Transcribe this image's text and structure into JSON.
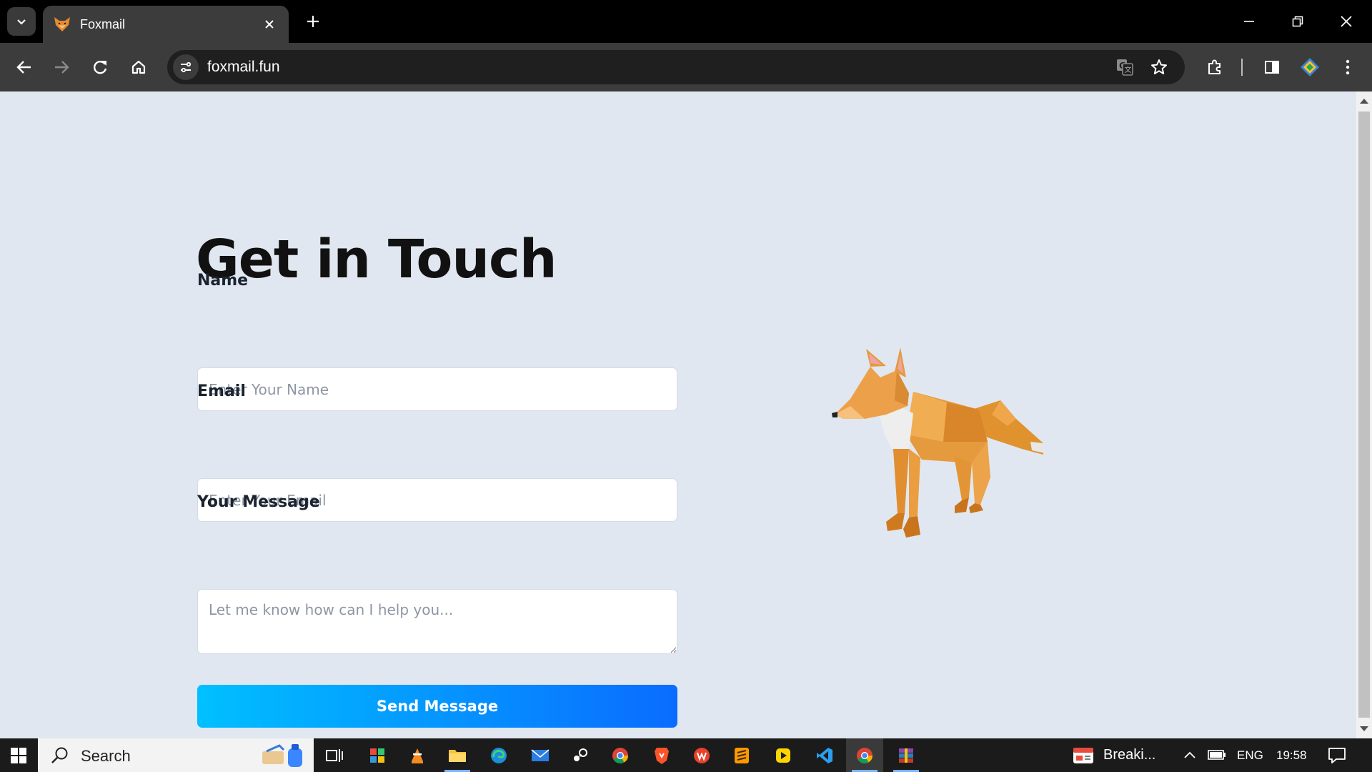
{
  "browser": {
    "tab_title": "Foxmail",
    "url": "foxmail.fun"
  },
  "page": {
    "heading": "Get in Touch",
    "name_label": "Name",
    "name_placeholder": "Enter Your Name",
    "email_label": "Email",
    "email_placeholder": "Enter Your Email",
    "message_label": "Your Message",
    "message_placeholder": "Let me know how can I help you...",
    "send_label": "Send Message",
    "accent_start": "#00c0ff",
    "accent_end": "#0a6cff"
  },
  "taskbar": {
    "search_label": "Search",
    "news_label": "Breaki...",
    "language": "ENG",
    "time": "19:58"
  }
}
